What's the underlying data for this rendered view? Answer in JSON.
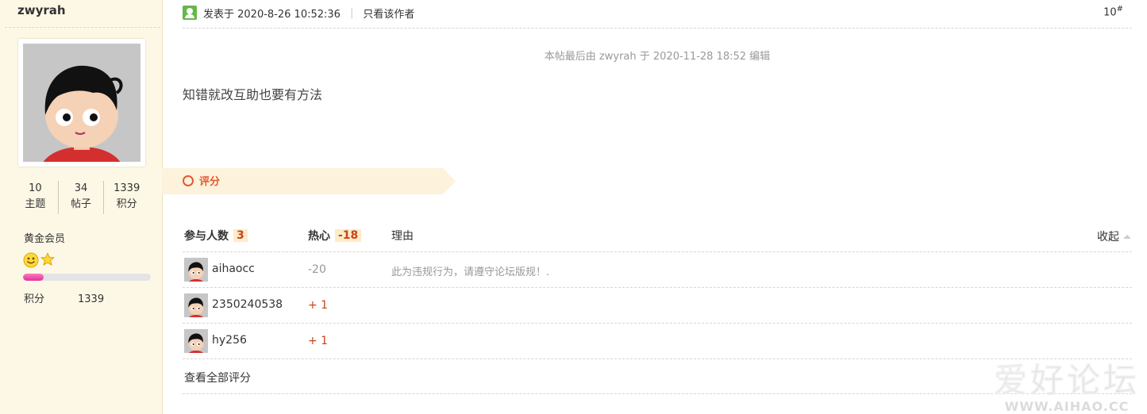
{
  "author": {
    "name": "zwyrah",
    "stats": [
      {
        "value": "10",
        "label": "主题"
      },
      {
        "value": "34",
        "label": "帖子"
      },
      {
        "value": "1339",
        "label": "积分"
      }
    ],
    "group": "黄金会员",
    "level_progress": 0.16,
    "points_label": "积分",
    "points_value": "1339"
  },
  "post": {
    "posted_at": "发表于 2020-8-26 10:52:36",
    "meta_sep": "|",
    "only_author": "只看该作者",
    "floor": "10",
    "floor_suffix": "#",
    "edit_note": "本帖最后由 zwyrah 于 2020-11-28 18:52 编辑",
    "content": "知错就改互助也要有方法"
  },
  "rating": {
    "title": "评分",
    "participants_label": "参与人数",
    "participants_count": "3",
    "score_label": "热心",
    "score_total": "-18",
    "reason_label": "理由",
    "collapse_label": "收起",
    "rows": [
      {
        "user": "aihaocc",
        "score": "-20",
        "reason": "此为违规行为，请遵守论坛版规！."
      },
      {
        "user": "2350240538",
        "score": "+ 1",
        "reason": ""
      },
      {
        "user": "hy256",
        "score": "+ 1",
        "reason": ""
      }
    ],
    "view_all": "查看全部评分"
  },
  "watermark": {
    "cn": "爱好论坛",
    "en": "WWW.AIHAO.CC"
  },
  "colors": {
    "sidebar_bg": "#fdf8e6",
    "accent": "#e35a2f",
    "positive": "#c7441c",
    "negative": "#999999"
  }
}
